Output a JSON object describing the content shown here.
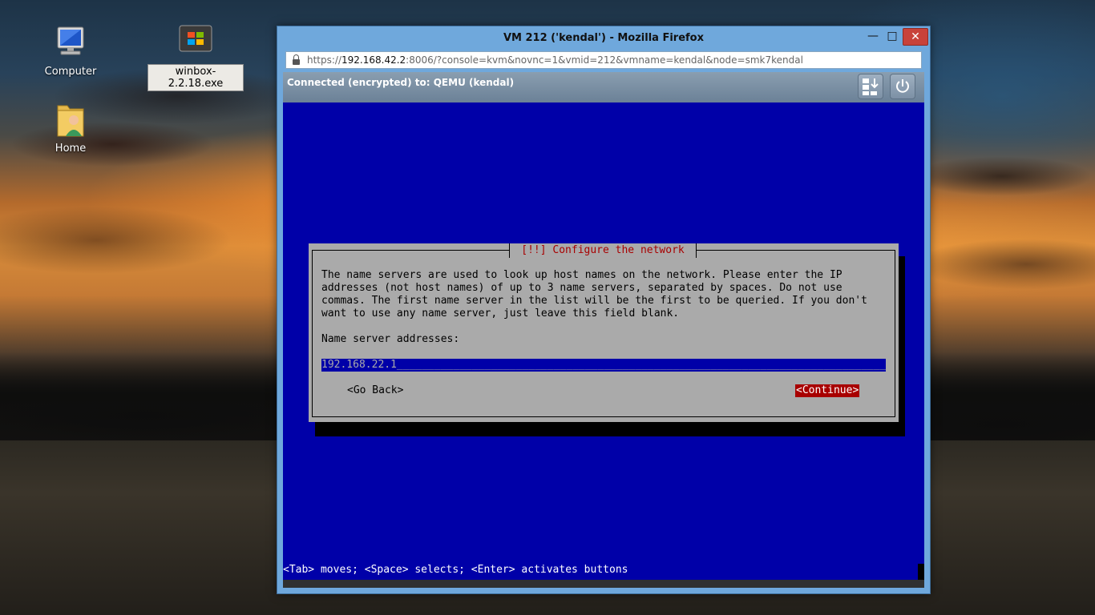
{
  "desktop": {
    "icons": [
      {
        "label": "Computer"
      },
      {
        "label": "winbox-2.2.18.exe"
      },
      {
        "label": "Home"
      }
    ]
  },
  "window": {
    "title": "VM 212 ('kendal') - Mozilla Firefox",
    "url_prefix": "https://",
    "url_host": "192.168.42.2",
    "url_rest": ":8006/?console=kvm&novnc=1&vmid=212&vmname=kendal&node=smk7kendal"
  },
  "vnc": {
    "status": "Connected (encrypted) to: QEMU (kendal)"
  },
  "installer": {
    "dialog_title": "[!!] Configure the network",
    "body_lines": [
      "The name servers are used to look up host names on the network. Please enter the IP",
      "addresses (not host names) of up to 3 name servers, separated by spaces. Do not use",
      "commas. The first name server in the list will be the first to be queried. If you don't",
      "want to use any name server, just leave this field blank."
    ],
    "field_label": "Name server addresses:",
    "field_value": "192.168.22.1",
    "go_back_label": "<Go Back>",
    "continue_label": "<Continue>",
    "help_text": "<Tab> moves; <Space> selects; <Enter> activates buttons"
  },
  "colors": {
    "console_bg": "#0000a8",
    "dialog_bg": "#aaaaaa",
    "accent_red": "#a80000"
  }
}
